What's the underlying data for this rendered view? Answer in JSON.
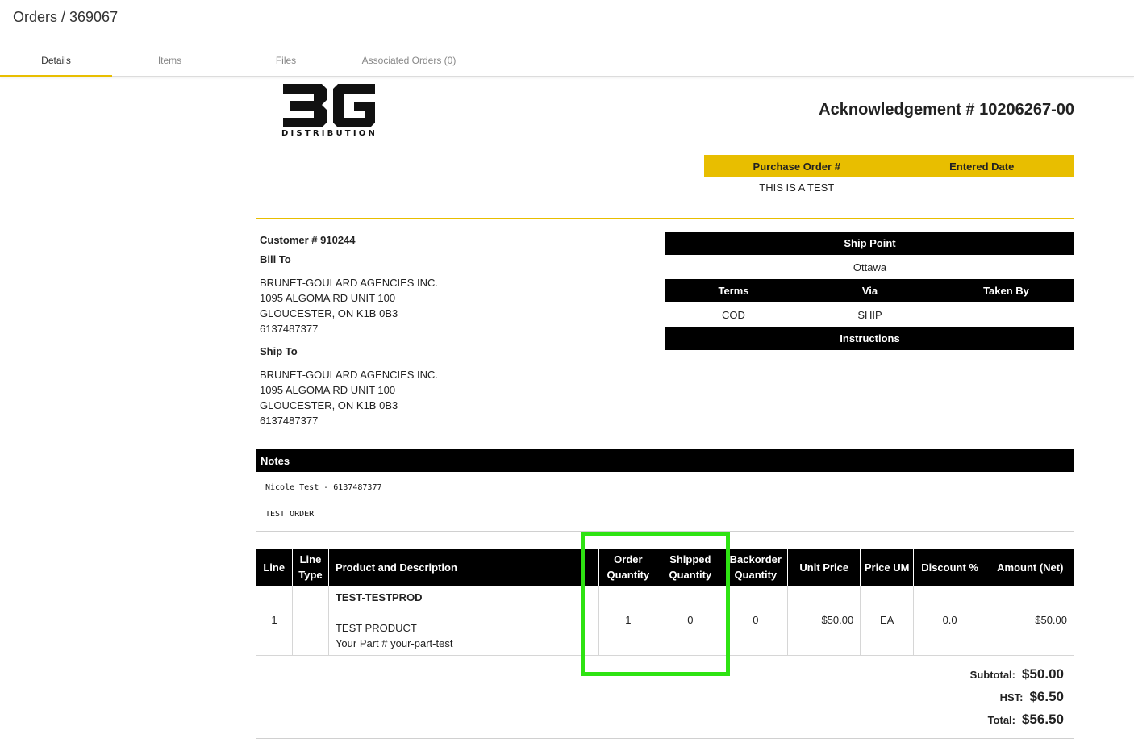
{
  "breadcrumb": "Orders / 369067",
  "tabs": [
    {
      "label": "Details",
      "active": true
    },
    {
      "label": "Items",
      "active": false
    },
    {
      "label": "Files",
      "active": false
    },
    {
      "label": "Associated Orders (0)",
      "active": false
    }
  ],
  "logo": {
    "brand": "3G",
    "subtitle": "DISTRIBUTION"
  },
  "acknowledgement_title": "Acknowledgement # 10206267-00",
  "po": {
    "headers": [
      "Purchase Order #",
      "Entered Date"
    ],
    "values": [
      "THIS IS A TEST",
      ""
    ]
  },
  "customer": {
    "number_label": "Customer # 910244",
    "bill_to_label": "Bill To",
    "bill_to": [
      "BRUNET-GOULARD AGENCIES INC.",
      "1095 ALGOMA RD UNIT 100",
      "GLOUCESTER, ON K1B 0B3",
      "6137487377"
    ],
    "ship_to_label": "Ship To",
    "ship_to": [
      "BRUNET-GOULARD AGENCIES INC.",
      "1095 ALGOMA RD UNIT 100",
      "GLOUCESTER, ON K1B 0B3",
      "6137487377"
    ]
  },
  "shipping": {
    "ship_point_label": "Ship Point",
    "ship_point": "Ottawa",
    "terms_headers": [
      "Terms",
      "Via",
      "Taken By"
    ],
    "terms_values": [
      "COD",
      "SHIP",
      ""
    ],
    "instructions_label": "Instructions"
  },
  "notes": {
    "label": "Notes",
    "lines": [
      "Nicole Test - 6137487377",
      "",
      "TEST ORDER"
    ]
  },
  "items_table": {
    "headers": [
      "Line",
      "Line Type",
      "Product and Description",
      "Order Quantity",
      "Shipped Quantity",
      "Backorder Quantity",
      "Unit Price",
      "Price UM",
      "Discount %",
      "Amount (Net)"
    ],
    "rows": [
      {
        "line": "1",
        "line_type": "",
        "product_code": "TEST-TESTPROD",
        "product_name": "TEST PRODUCT",
        "your_part": "Your Part # your-part-test",
        "order_qty": "1",
        "shipped_qty": "0",
        "backorder_qty": "0",
        "unit_price": "$50.00",
        "price_um": "EA",
        "discount": "0.0",
        "amount": "$50.00"
      }
    ]
  },
  "totals": {
    "subtotal_label": "Subtotal:",
    "subtotal": "$50.00",
    "hst_label": "HST:",
    "hst": "$6.50",
    "total_label": "Total:",
    "total": "$56.50"
  },
  "colors": {
    "accent": "#e8be00",
    "highlight": "#2ee312",
    "header_bg": "#000000"
  }
}
